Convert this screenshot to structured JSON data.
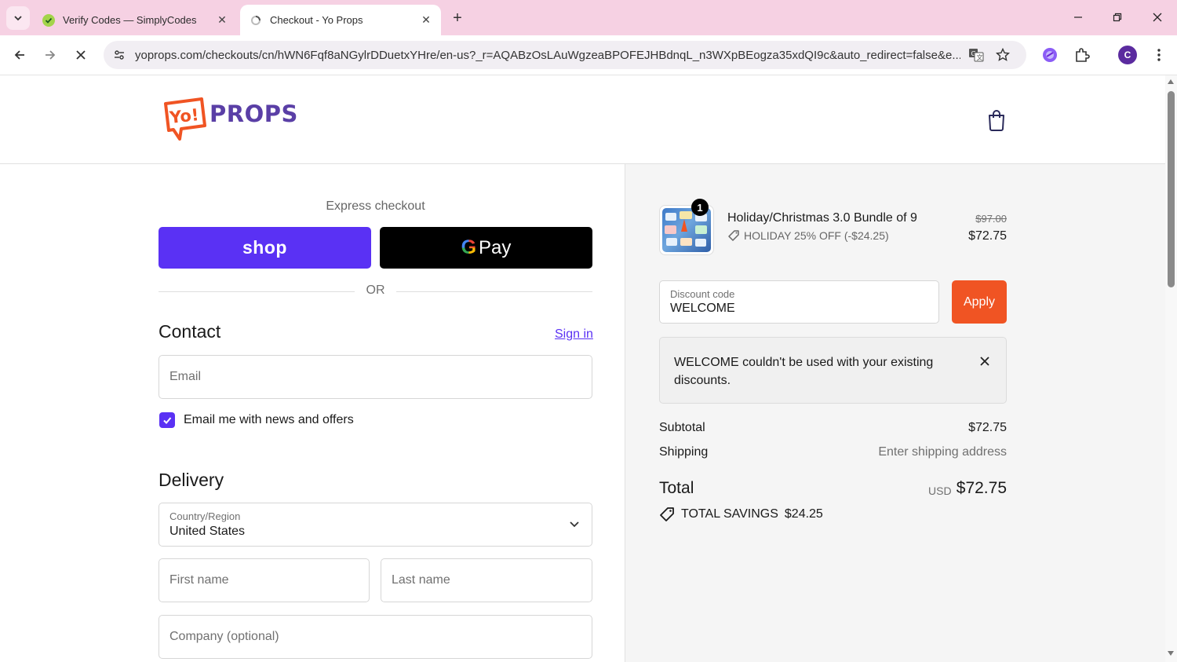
{
  "browser": {
    "tabs": [
      {
        "title": "Verify Codes — SimplyCodes",
        "active": false
      },
      {
        "title": "Checkout - Yo Props",
        "active": true
      }
    ],
    "url": "yoprops.com/checkouts/cn/hWN6Fqf8aNGylrDDuetxYHre/en-us?_r=AQABzOsLAuWgzeaBPOFEJHBdnqL_n3WXpBEogza35xdQI9c&auto_redirect=false&e...",
    "profile_initial": "C",
    "accent_color": "#f6d1e3"
  },
  "header": {
    "logo_bubble_text": "Yo!",
    "logo_word": "PROPS"
  },
  "express": {
    "title": "Express checkout",
    "shop_label": "shop",
    "gpay_g": "G",
    "gpay_label": "Pay",
    "or_label": "OR"
  },
  "contact": {
    "title": "Contact",
    "signin_label": "Sign in",
    "email_placeholder": "Email",
    "newsletter_label": "Email me with news and offers",
    "newsletter_checked": true
  },
  "delivery": {
    "title": "Delivery",
    "country_label": "Country/Region",
    "country_value": "United States",
    "first_name_placeholder": "First name",
    "last_name_placeholder": "Last name",
    "company_placeholder": "Company (optional)"
  },
  "summary": {
    "product": {
      "quantity": "1",
      "name": "Holiday/Christmas 3.0 Bundle of 9",
      "discount": "HOLIDAY 25% OFF (-$24.25)",
      "original_price": "$97.00",
      "price": "$72.75"
    },
    "discount_field": {
      "label": "Discount code",
      "value": "WELCOME",
      "apply_label": "Apply"
    },
    "notice": "WELCOME couldn't be used with your existing discounts.",
    "subtotal_label": "Subtotal",
    "subtotal_value": "$72.75",
    "shipping_label": "Shipping",
    "shipping_value": "Enter shipping address",
    "total_label": "Total",
    "total_currency": "USD",
    "total_value": "$72.75",
    "savings_label": "TOTAL SAVINGS",
    "savings_value": "$24.25"
  },
  "colors": {
    "shop_purple": "#5a31f4",
    "apply_orange": "#f05423",
    "logo_purple": "#5a3fa6",
    "logo_orange": "#f05423"
  }
}
